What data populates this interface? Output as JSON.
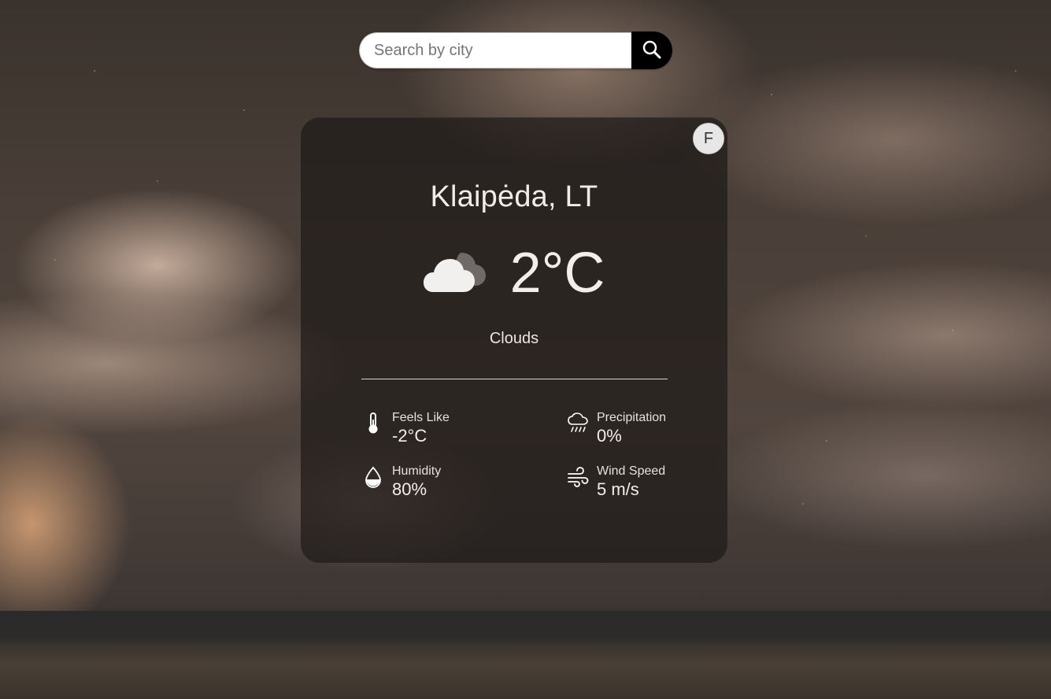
{
  "search": {
    "placeholder": "Search by city",
    "value": ""
  },
  "unit_toggle": {
    "label": "F"
  },
  "weather": {
    "city": "Klaipėda, LT",
    "temperature": "2°C",
    "condition": "Clouds",
    "icon": "cloud-icon"
  },
  "stats": {
    "feels_like": {
      "label": "Feels Like",
      "value": "-2°C",
      "icon": "thermometer-icon"
    },
    "precipitation": {
      "label": "Precipitation",
      "value": "0%",
      "icon": "rain-cloud-icon"
    },
    "humidity": {
      "label": "Humidity",
      "value": "80%",
      "icon": "water-drop-icon"
    },
    "wind_speed": {
      "label": "Wind Speed",
      "value": "5 m/s",
      "icon": "wind-icon"
    }
  },
  "colors": {
    "card_background": "#1f1b19",
    "search_button": "#000000",
    "text": "#efe9e5"
  }
}
